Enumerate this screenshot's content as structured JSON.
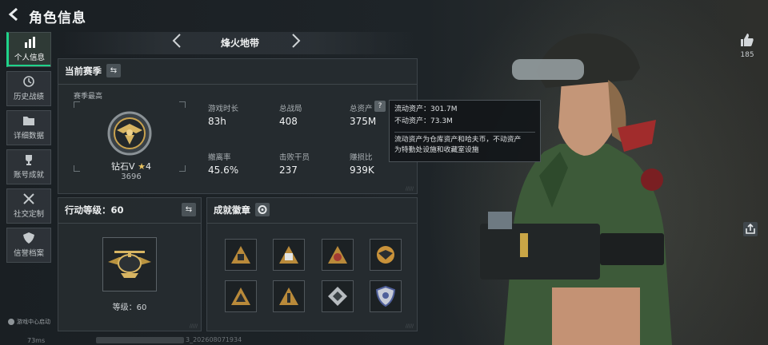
{
  "header": {
    "back_icon": "back-arrow-icon",
    "title": "角色信息"
  },
  "sidebar": {
    "items": [
      {
        "label": "个人信息",
        "icon": "chart-icon",
        "active": true
      },
      {
        "label": "历史战绩",
        "icon": "clock-icon",
        "active": false
      },
      {
        "label": "详细数据",
        "icon": "folder-icon",
        "active": false
      },
      {
        "label": "账号成就",
        "icon": "trophy-icon",
        "active": false
      },
      {
        "label": "社交定制",
        "icon": "tools-icon",
        "active": false
      },
      {
        "label": "信誉档案",
        "icon": "shield-icon",
        "active": false
      }
    ],
    "game_center": "游戏中心启动"
  },
  "footer": {
    "ping": "73ms",
    "uid_suffix": "3_202608071934"
  },
  "mode_selector": {
    "label": "烽火地带"
  },
  "season": {
    "header": "当前赛季",
    "peak_label": "赛季最高",
    "rank_name": "钻石V",
    "rank_stars": "4",
    "rank_points": "3696",
    "stats": [
      {
        "label": "游戏时长",
        "value": "83h"
      },
      {
        "label": "总战局",
        "value": "408"
      },
      {
        "label": "总资产",
        "value": "375M"
      },
      {
        "label": "撤离率",
        "value": "45.6%"
      },
      {
        "label": "击败干员",
        "value": "237"
      },
      {
        "label": "赚损比",
        "value": "939K"
      }
    ]
  },
  "tooltip": {
    "liquid": "流动资产：301.7M",
    "fixed": "不动资产：73.3M",
    "desc_line1": "流动资产为仓库资产和哈夫币，不动资产",
    "desc_line2": "为特勤处设施和收藏室设施"
  },
  "action_level": {
    "header": "行动等级：60",
    "level_text": "等级：60"
  },
  "badges": {
    "header": "成就徽章",
    "items": [
      "badge-1",
      "badge-2",
      "badge-3",
      "badge-4",
      "badge-5",
      "badge-6",
      "badge-7",
      "badge-8"
    ]
  },
  "likes": {
    "count": "185"
  },
  "colors": {
    "accent": "#1fd38a",
    "panel": "#262c30"
  }
}
